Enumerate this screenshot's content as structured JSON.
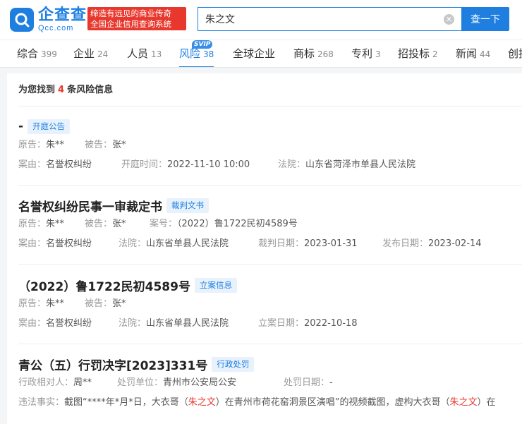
{
  "brand": {
    "name_cn": "企查查",
    "name_en": "Qcc.com",
    "slogan_line1": "缔造有远见的商业传奇",
    "slogan_line2": "全国企业信用查询系统"
  },
  "search": {
    "value": "朱之文",
    "button_label": "查一下"
  },
  "tabs": [
    {
      "label": "综合",
      "count": "399"
    },
    {
      "label": "企业",
      "count": "24"
    },
    {
      "label": "人员",
      "count": "13"
    },
    {
      "label": "风险",
      "count": "38",
      "badge": "SVIP",
      "active": true
    },
    {
      "label": "全球企业",
      "count": ""
    },
    {
      "label": "商标",
      "count": "268"
    },
    {
      "label": "专利",
      "count": "3"
    },
    {
      "label": "招投标",
      "count": "2"
    },
    {
      "label": "新闻",
      "count": "44"
    },
    {
      "label": "创投",
      "count": ""
    }
  ],
  "summary": {
    "prefix": "为您找到",
    "count": "4",
    "suffix": "条风险信息"
  },
  "items": [
    {
      "title": "-",
      "tag": "开庭公告",
      "row1": {
        "plaintiff_label": "原告：",
        "plaintiff": "朱**",
        "defendant_label": "被告：",
        "defendant": "张*"
      },
      "row2": {
        "cause_label": "案由：",
        "cause": "名誉权纠纷",
        "time_label": "开庭时间：",
        "time": "2022-11-10 10:00",
        "court_label": "法院：",
        "court": "山东省菏泽市单县人民法院"
      }
    },
    {
      "title": "名誉权纠纷民事一审裁定书",
      "tag": "裁判文书",
      "row1": {
        "plaintiff_label": "原告：",
        "plaintiff": "朱**",
        "defendant_label": "被告：",
        "defendant": "张*",
        "case_label": "案号：",
        "case": "（2022）鲁1722民初4589号"
      },
      "row2": {
        "cause_label": "案由：",
        "cause": "名誉权纠纷",
        "court_label": "法院：",
        "court": "山东省单县人民法院",
        "judge_date_label": "裁判日期：",
        "judge_date": "2023-01-31",
        "pub_date_label": "发布日期：",
        "pub_date": "2023-02-14"
      }
    },
    {
      "title": "（2022）鲁1722民初4589号",
      "tag": "立案信息",
      "row1": {
        "plaintiff_label": "原告：",
        "plaintiff": "朱**",
        "defendant_label": "被告：",
        "defendant": "张*"
      },
      "row2": {
        "cause_label": "案由：",
        "cause": "名誉权纠纷",
        "court_label": "法院：",
        "court": "山东省单县人民法院",
        "file_date_label": "立案日期：",
        "file_date": "2022-10-18"
      }
    },
    {
      "title": "青公（五）行罚决字[2023]331号",
      "tag": "行政处罚",
      "row1": {
        "party_label": "行政相对人：",
        "party": "周**",
        "unit_label": "处罚单位：",
        "unit": "青州市公安局公安",
        "date_label": "处罚日期：",
        "date": "-"
      },
      "row2": {
        "fact_label": "违法事实：",
        "fact_a": "截图“****年*月*日，大衣哥（",
        "fact_name1": "朱之文",
        "fact_b": "）在青州市荷花窑洞景区演唱”的视频截图，虚构大衣哥（",
        "fact_name2": "朱之文",
        "fact_c": "）在"
      }
    }
  ]
}
